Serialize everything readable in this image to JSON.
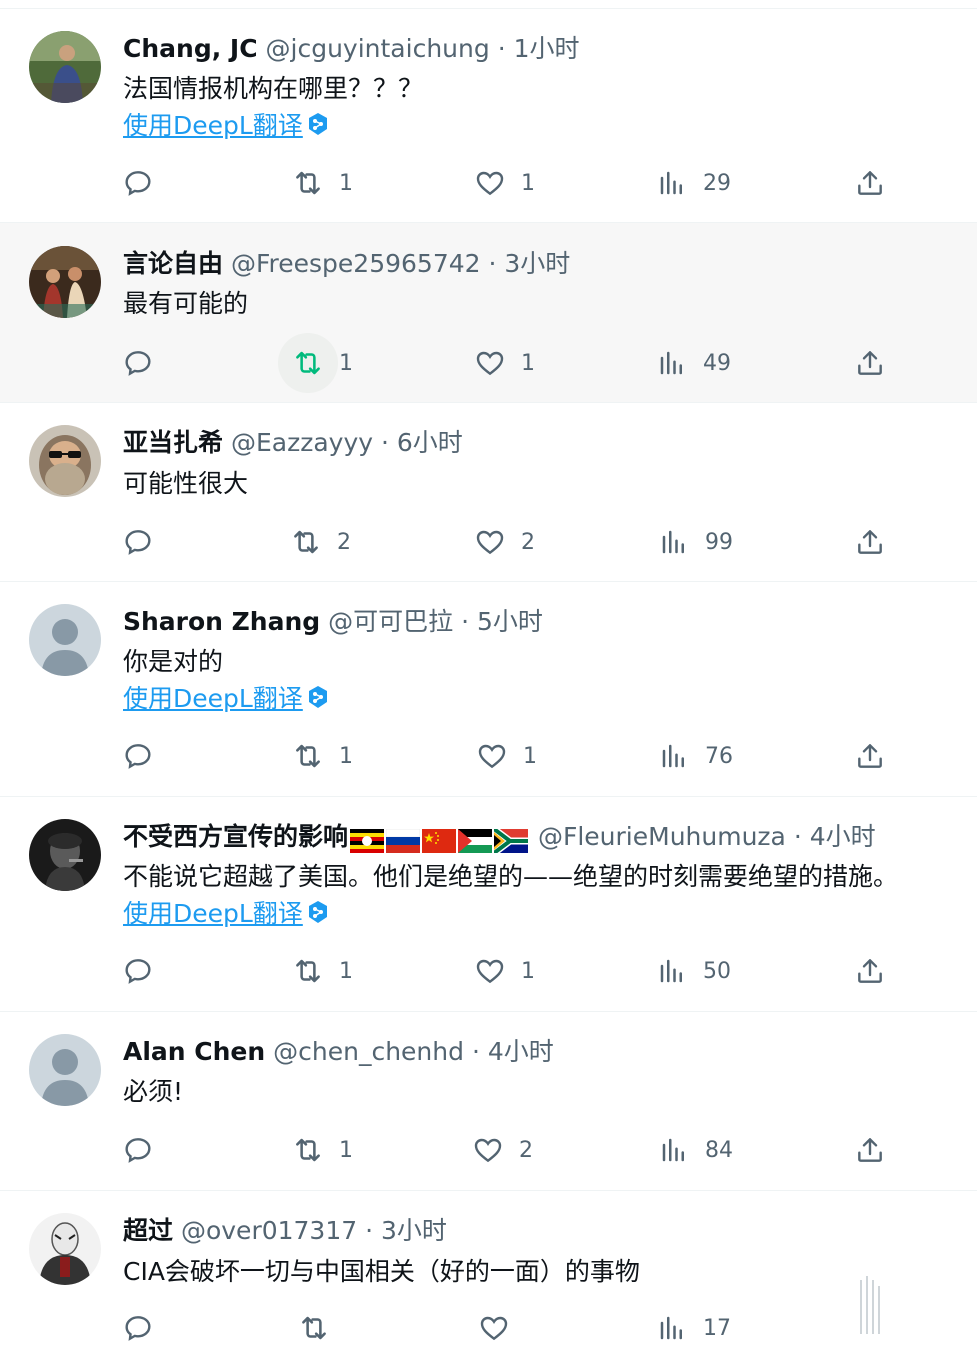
{
  "translate_label": "使用DeepL翻译",
  "tweets": [
    {
      "name": "Chang, JC",
      "handle": "@jcguyintaichung",
      "sep": "·",
      "time": "1小时",
      "text": "法国情报机构在哪里？？？",
      "translate": true,
      "replies": "",
      "retweets": "1",
      "likes": "1",
      "views": "29"
    },
    {
      "name": "言论自由",
      "handle": "@Freespe25965742",
      "sep": "·",
      "time": "3小时",
      "text": "最有可能的",
      "translate": false,
      "replies": "",
      "retweets": "1",
      "likes": "1",
      "views": "49"
    },
    {
      "name": "亚当扎希",
      "handle": "@Eazzayyy",
      "sep": "·",
      "time": "6小时",
      "text": "可能性很大",
      "translate": false,
      "replies": "",
      "retweets": "2",
      "likes": "2",
      "views": "99"
    },
    {
      "name": "Sharon Zhang",
      "handle": "@可可巴拉",
      "sep": "·",
      "time": "5小时",
      "text": "你是对的",
      "translate": true,
      "replies": "",
      "retweets": "1",
      "likes": "1",
      "views": "76"
    },
    {
      "name": "不受西方宣传的影响",
      "handle": "@FleurieMuhumuza",
      "sep": "·",
      "time": "4小时",
      "text": "不能说它超越了美国。他们是绝望的——绝望的时刻需要绝望的措施。",
      "translate": true,
      "flags": [
        "uganda-flag-emoji",
        "russia-flag-emoji",
        "china-flag-emoji",
        "palestine-flag-emoji",
        "south-africa-flag-emoji"
      ],
      "replies": "",
      "retweets": "1",
      "likes": "1",
      "views": "50"
    },
    {
      "name": "Alan Chen",
      "handle": "@chen_chenhd",
      "sep": "·",
      "time": "4小时",
      "text": "必须!",
      "translate": false,
      "replies": "",
      "retweets": "1",
      "likes": "2",
      "views": "84"
    },
    {
      "name": "超过",
      "handle": "@over017317",
      "sep": "·",
      "time": "3小时",
      "text": "CIA会破坏一切与中国相关（好的一面）的事物",
      "translate": false,
      "replies": "",
      "retweets": "",
      "likes": "",
      "views": "17"
    }
  ],
  "colors": {
    "text": "#0f1419",
    "secondary": "#536471",
    "link": "#1d9bf0",
    "divider": "#eff3f4",
    "hover_bg": "#f7f7f7",
    "retweet_active": "#00ba7c"
  },
  "icons": {
    "reply": "reply-bubble-icon",
    "retweet": "retweet-arrows-icon",
    "like": "heart-icon",
    "views": "bar-chart-views-icon",
    "share": "share-upload-icon",
    "deepl": "deepl-logo-icon"
  }
}
